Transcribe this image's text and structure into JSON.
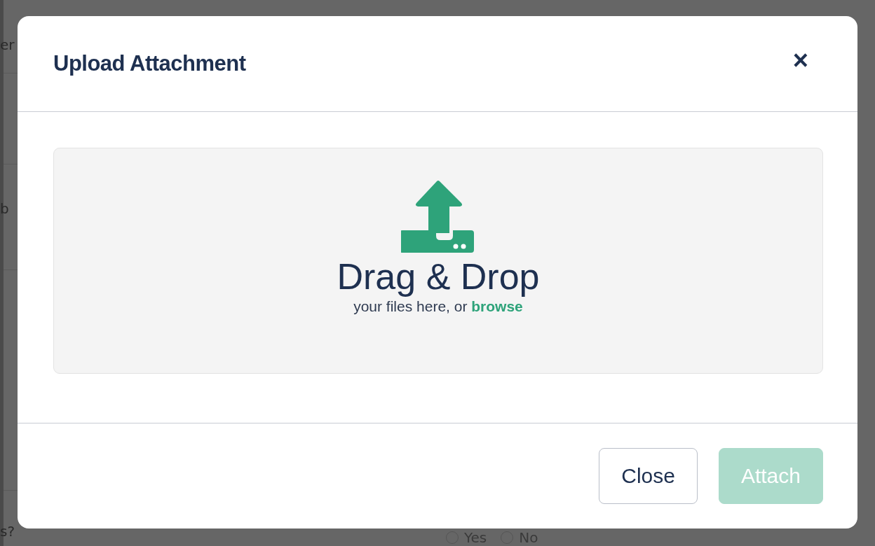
{
  "background": {
    "fragments": [
      "er",
      "b",
      "s?"
    ],
    "radios": [
      {
        "label": "Yes",
        "selected": false
      },
      {
        "label": "No",
        "selected": false
      }
    ]
  },
  "modal": {
    "title": "Upload Attachment",
    "close_icon": "×",
    "dropzone": {
      "headline": "Drag & Drop",
      "hint": "your files here, or ",
      "link": "browse"
    },
    "buttons": [
      {
        "label": "Close",
        "kind": "secondary",
        "disabled": false
      },
      {
        "label": "Attach",
        "kind": "primary",
        "disabled": true
      }
    ]
  }
}
